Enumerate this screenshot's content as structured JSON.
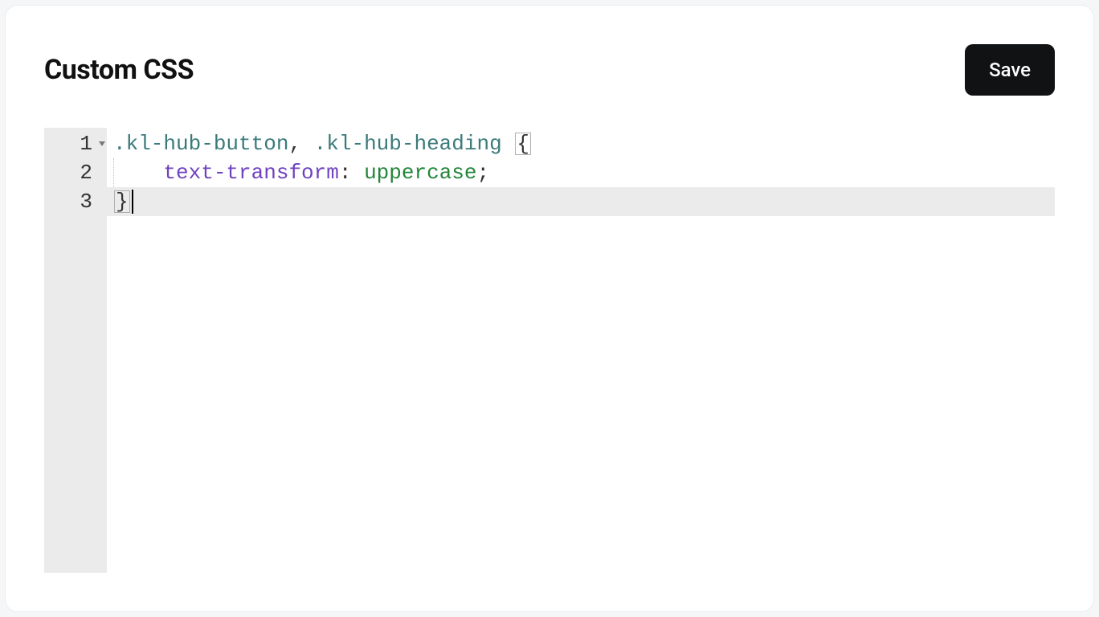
{
  "header": {
    "title": "Custom CSS",
    "save_label": "Save"
  },
  "editor": {
    "line_numbers": [
      "1",
      "2",
      "3"
    ],
    "active_line_index": 2,
    "fold_on_line_index": 0,
    "lines": [
      {
        "tokens": [
          {
            "cls": "tok-selector",
            "text": ".kl-hub-button"
          },
          {
            "cls": "tok-punct",
            "text": ", "
          },
          {
            "cls": "tok-selector",
            "text": ".kl-hub-heading"
          },
          {
            "cls": "tok-punct",
            "text": " "
          },
          {
            "cls": "tok-punct bracket-box",
            "text": "{"
          }
        ],
        "indent": 0
      },
      {
        "tokens": [
          {
            "cls": "tok-prop",
            "text": "text-transform"
          },
          {
            "cls": "tok-colon",
            "text": ": "
          },
          {
            "cls": "tok-value",
            "text": "uppercase"
          },
          {
            "cls": "tok-semi",
            "text": ";"
          }
        ],
        "indent": 1
      },
      {
        "tokens": [
          {
            "cls": "tok-punct bracket-box",
            "text": "}"
          }
        ],
        "indent": 0,
        "cursor_after": true
      }
    ]
  }
}
